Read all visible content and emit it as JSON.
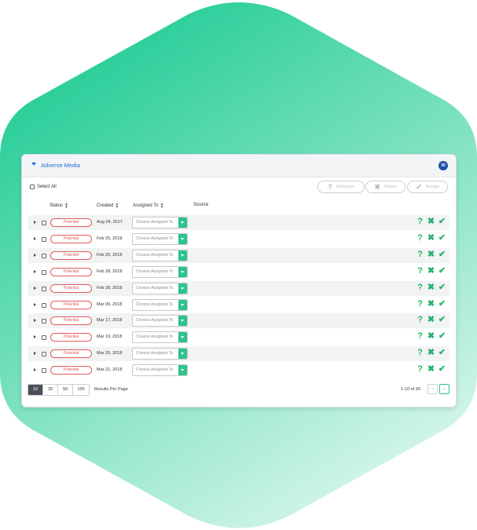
{
  "panel": {
    "title": "Adverse Media",
    "count_badge": "30",
    "select_all_label": "Select All",
    "actions": {
      "unknown": {
        "icon": "question-icon",
        "label": "Unknown"
      },
      "reject": {
        "icon": "x-icon",
        "label": "Reject"
      },
      "accept": {
        "icon": "check-icon",
        "label": "Accept"
      }
    },
    "columns": [
      "Status",
      "Created",
      "Assigned To",
      "Source"
    ],
    "rows": [
      {
        "status": "Potential",
        "created": "Aug 24, 2017",
        "assigned_placeholder": "Choose Assigned To"
      },
      {
        "status": "Potential",
        "created": "Feb 25, 2018",
        "assigned_placeholder": "Choose Assigned To"
      },
      {
        "status": "Potential",
        "created": "Feb 25, 2018",
        "assigned_placeholder": "Choose Assigned To"
      },
      {
        "status": "Potential",
        "created": "Feb 28, 2018",
        "assigned_placeholder": "Choose Assigned To"
      },
      {
        "status": "Potential",
        "created": "Feb 28, 2018",
        "assigned_placeholder": "Choose Assigned To"
      },
      {
        "status": "Potential",
        "created": "Mar 09, 2018",
        "assigned_placeholder": "Choose Assigned To"
      },
      {
        "status": "Potential",
        "created": "Mar 17, 2018",
        "assigned_placeholder": "Choose Assigned To"
      },
      {
        "status": "Potential",
        "created": "Mar 19, 2018",
        "assigned_placeholder": "Choose Assigned To"
      },
      {
        "status": "Potential",
        "created": "Mar 20, 2018",
        "assigned_placeholder": "Choose Assigned To"
      },
      {
        "status": "Potential",
        "created": "Mar 21, 2018",
        "assigned_placeholder": "Choose Assigned To"
      }
    ],
    "row_actions": {
      "unknown": "?",
      "reject": "✖",
      "accept": "✔"
    },
    "pagination": {
      "page_sizes": [
        "10",
        "25",
        "50",
        "100"
      ],
      "selected_page_size": "10",
      "results_per_page_label": "Results Per Page",
      "range_text": "1-10 of 30",
      "prev": "‹",
      "next": "›"
    }
  },
  "colors": {
    "hex_top": "#2fcf9c",
    "hex_bottom": "#d3f5ea",
    "accent": "#2dc48a",
    "status_potential": "#e05a5a",
    "title_blue": "#2a6fd6"
  }
}
